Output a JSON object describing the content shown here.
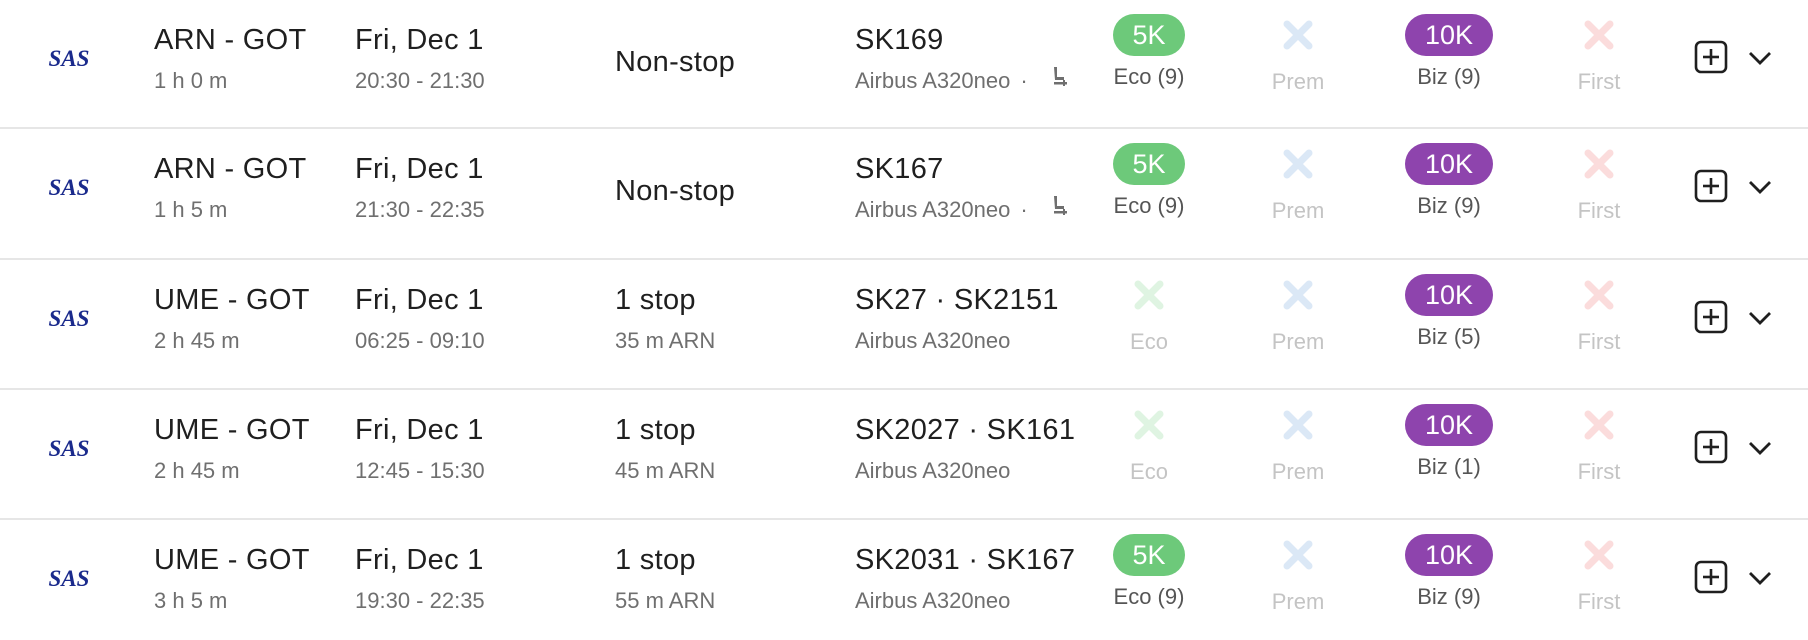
{
  "flights": [
    {
      "airline": "SAS",
      "route": "ARN - GOT",
      "duration": "1 h 0 m",
      "date": "Fri, Dec 1",
      "time": "20:30 - 21:30",
      "stops": "Non-stop",
      "layover": "",
      "flight_numbers": "SK169",
      "aircraft": "Airbus A320neo",
      "seat_icon": true,
      "eco": {
        "available": true,
        "price": "5K",
        "label": "Eco (9)"
      },
      "prem": {
        "available": false,
        "price": "",
        "label": "Prem"
      },
      "biz": {
        "available": true,
        "price": "10K",
        "label": "Biz (9)"
      },
      "first": {
        "available": false,
        "price": "",
        "label": "First"
      }
    },
    {
      "airline": "SAS",
      "route": "ARN - GOT",
      "duration": "1 h 5 m",
      "date": "Fri, Dec 1",
      "time": "21:30 - 22:35",
      "stops": "Non-stop",
      "layover": "",
      "flight_numbers": "SK167",
      "aircraft": "Airbus A320neo",
      "seat_icon": true,
      "eco": {
        "available": true,
        "price": "5K",
        "label": "Eco (9)"
      },
      "prem": {
        "available": false,
        "price": "",
        "label": "Prem"
      },
      "biz": {
        "available": true,
        "price": "10K",
        "label": "Biz (9)"
      },
      "first": {
        "available": false,
        "price": "",
        "label": "First"
      }
    },
    {
      "airline": "SAS",
      "route": "UME - GOT",
      "duration": "2 h 45 m",
      "date": "Fri, Dec 1",
      "time": "06:25 - 09:10",
      "stops": "1 stop",
      "layover": "35 m  ARN",
      "flight_numbers": "SK27  ·  SK2151",
      "aircraft": "Airbus A320neo",
      "seat_icon": false,
      "eco": {
        "available": false,
        "price": "",
        "label": "Eco"
      },
      "prem": {
        "available": false,
        "price": "",
        "label": "Prem"
      },
      "biz": {
        "available": true,
        "price": "10K",
        "label": "Biz (5)"
      },
      "first": {
        "available": false,
        "price": "",
        "label": "First"
      }
    },
    {
      "airline": "SAS",
      "route": "UME - GOT",
      "duration": "2 h 45 m",
      "date": "Fri, Dec 1",
      "time": "12:45 - 15:30",
      "stops": "1 stop",
      "layover": "45 m  ARN",
      "flight_numbers": "SK2027  ·  SK161",
      "aircraft": "Airbus A320neo",
      "seat_icon": false,
      "eco": {
        "available": false,
        "price": "",
        "label": "Eco"
      },
      "prem": {
        "available": false,
        "price": "",
        "label": "Prem"
      },
      "biz": {
        "available": true,
        "price": "10K",
        "label": "Biz (1)"
      },
      "first": {
        "available": false,
        "price": "",
        "label": "First"
      }
    },
    {
      "airline": "SAS",
      "route": "UME - GOT",
      "duration": "3 h 5 m",
      "date": "Fri, Dec 1",
      "time": "19:30 - 22:35",
      "stops": "1 stop",
      "layover": "55 m  ARN",
      "flight_numbers": "SK2031  ·  SK167",
      "aircraft": "Airbus A320neo",
      "seat_icon": false,
      "eco": {
        "available": true,
        "price": "5K",
        "label": "Eco (9)"
      },
      "prem": {
        "available": false,
        "price": "",
        "label": "Prem"
      },
      "biz": {
        "available": true,
        "price": "10K",
        "label": "Biz (9)"
      },
      "first": {
        "available": false,
        "price": "",
        "label": "First"
      }
    }
  ],
  "colors": {
    "eco_badge": "#6dc97a",
    "biz_badge": "#8e44ad",
    "eco_unavailable_x": "#dff4e2",
    "prem_unavailable_x": "#dbe8f6",
    "first_unavailable_x": "#fbdcdc",
    "airline_logo": "#1a2a8c"
  },
  "icons": {
    "logo": "sas-logo-icon",
    "seat": "seat-icon",
    "add": "plus-square-icon",
    "expand": "chevron-down-icon",
    "unavailable": "x-icon"
  }
}
